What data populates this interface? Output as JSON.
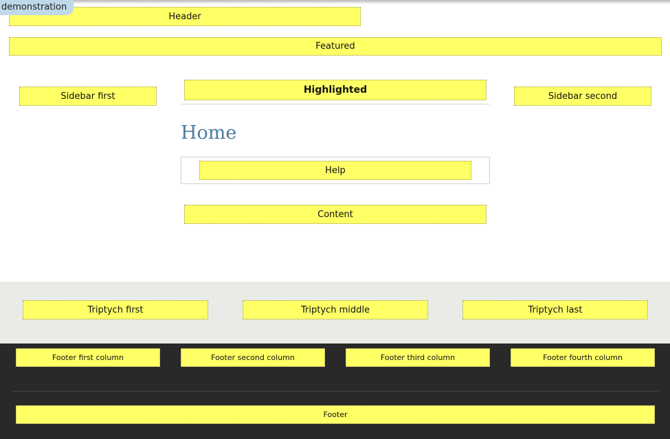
{
  "demo_tag": "demonstration",
  "header": "Header",
  "featured": "Featured",
  "sidebar_first": "Sidebar first",
  "highlighted": "Highlighted",
  "sidebar_second": "Sidebar second",
  "page_title": "Home",
  "help": "Help",
  "content": "Content",
  "triptych": {
    "first": "Triptych first",
    "middle": "Triptych middle",
    "last": "Triptych last"
  },
  "footer_columns": {
    "first": "Footer first column",
    "second": "Footer second column",
    "third": "Footer third column",
    "fourth": "Footer fourth column"
  },
  "footer": "Footer",
  "colors": {
    "region_fill": "#ffff66",
    "triptych_band": "#e9ebe7",
    "footer_band": "#292929",
    "title": "#4a7da0",
    "demo_tag": "#bfd8ea"
  }
}
